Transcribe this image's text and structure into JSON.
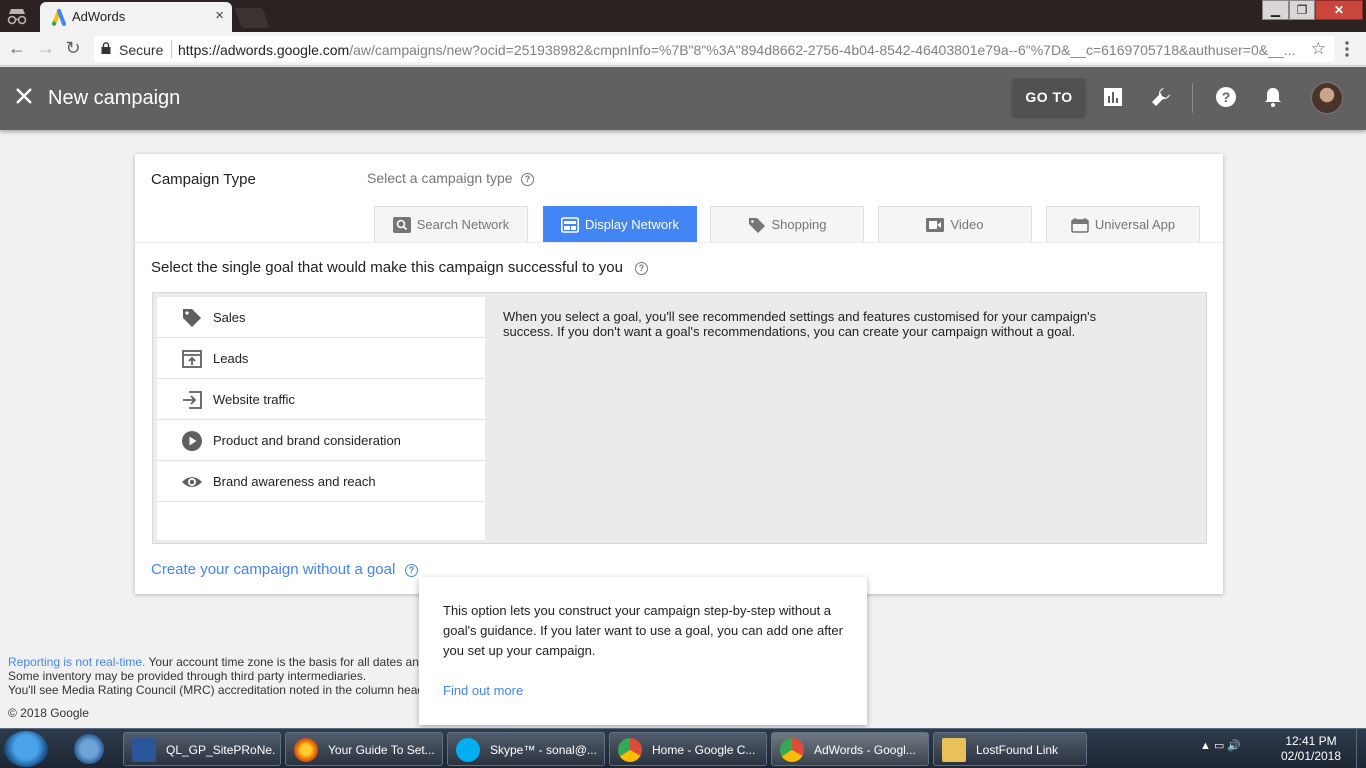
{
  "browser": {
    "tab_title": "AdWords",
    "tab_close": "×",
    "secure_label": "Secure",
    "url_host": "https://adwords.google.com",
    "url_rest": "/aw/campaigns/new?ocid=251938982&cmpnInfo=%7B\"8\"%3A\"894d8662-2756-4b04-8542-46403801e79a--6\"%7D&__c=6169705718&authuser=0&__..."
  },
  "header": {
    "title": "New campaign",
    "goto_label": "GO TO"
  },
  "campaign_type": {
    "label": "Campaign Type",
    "hint": "Select a campaign type",
    "types": [
      {
        "label": "Search Network",
        "active": false
      },
      {
        "label": "Display Network",
        "active": true
      },
      {
        "label": "Shopping",
        "active": false
      },
      {
        "label": "Video",
        "active": false
      },
      {
        "label": "Universal App",
        "active": false
      }
    ]
  },
  "goals": {
    "question": "Select the single goal that would make this campaign successful to you",
    "items": [
      {
        "label": "Sales",
        "icon": "tag-icon"
      },
      {
        "label": "Leads",
        "icon": "leads-icon"
      },
      {
        "label": "Website traffic",
        "icon": "traffic-icon"
      },
      {
        "label": "Product and brand consideration",
        "icon": "play-icon"
      },
      {
        "label": "Brand awareness and reach",
        "icon": "eye-icon"
      }
    ],
    "description": "When you select a goal, you'll see recommended settings and features customised for your campaign's success. If you don't want a goal's recommendations, you can create your campaign without a goal.",
    "no_goal_link": "Create your campaign without a goal"
  },
  "tooltip": {
    "body": "This option lets you construct your campaign step-by-step without a goal's guidance. If you later want to use a goal, you can add one after you set up your campaign.",
    "link": "Find out more"
  },
  "footer": {
    "reporting_link": "Reporting is not real-time.",
    "line1_rest": " Your account time zone is the basis for all dates and times",
    "line2": "Some inventory may be provided through third party intermediaries.",
    "line3": "You'll see Media Rating Council (MRC) accreditation noted in the column header",
    "copyright": "© 2018 Google"
  },
  "taskbar": {
    "apps": [
      {
        "label": "QL_GP_SitePRoNe...",
        "color": "#2b579a"
      },
      {
        "label": "Your Guide To Set...",
        "color": "#e66000"
      },
      {
        "label": "Skype™ - sonal@...",
        "color": "#00aff0"
      },
      {
        "label": "Home - Google C...",
        "color": "#dd4b39"
      },
      {
        "label": "AdWords - Googl...",
        "color": "#dd4b39"
      },
      {
        "label": "LostFound Link",
        "color": "#e8c15a"
      }
    ],
    "time": "12:41 PM",
    "date": "02/01/2018"
  },
  "colors": {
    "accent": "#4285f4",
    "header_bg": "#616161"
  }
}
